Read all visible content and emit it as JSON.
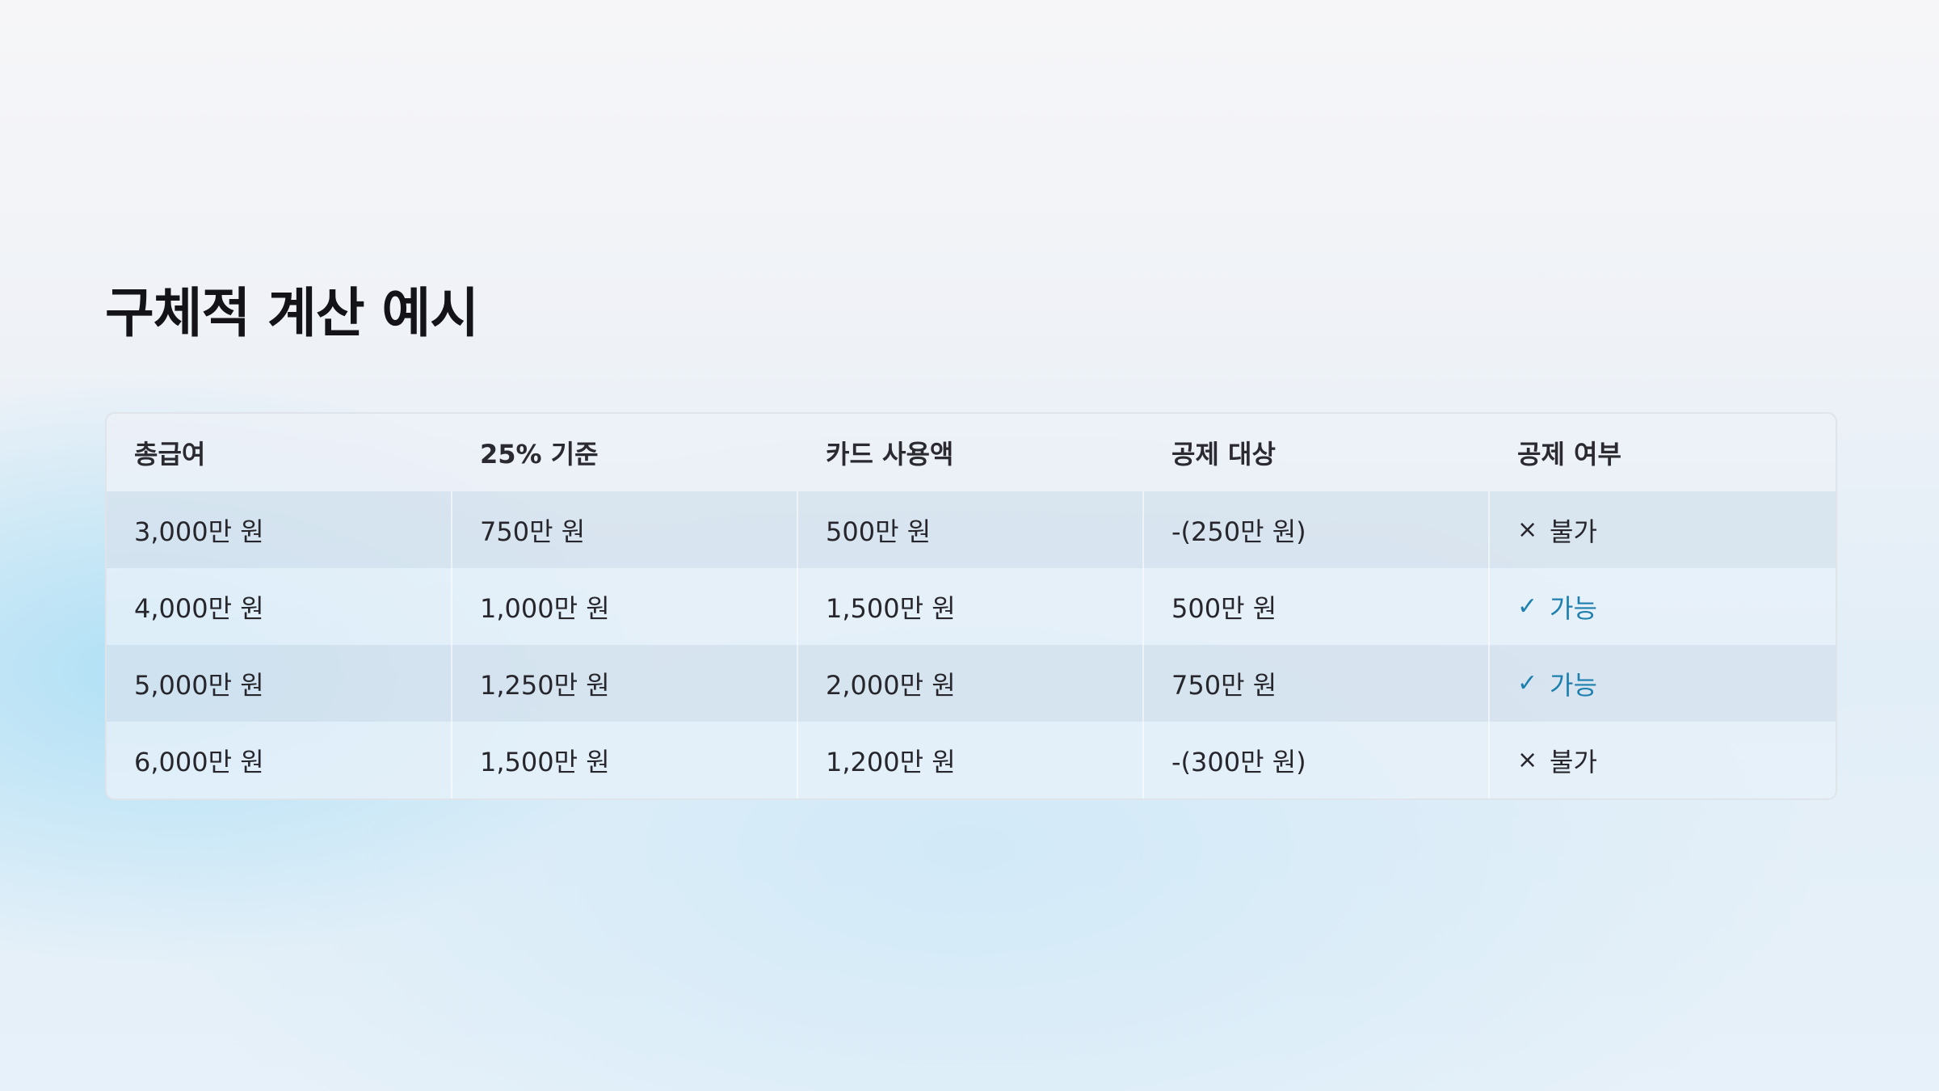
{
  "title": "구체적 계산 예시",
  "table": {
    "headers": [
      "총급여",
      "25% 기준",
      "카드 사용액",
      "공제 대상",
      "공제 여부"
    ],
    "rows": [
      {
        "salary": "3,000만 원",
        "threshold": "750만 원",
        "card": "500만 원",
        "deductible": "-(250만 원)",
        "status_icon": "×",
        "status": "불가",
        "eligible": false
      },
      {
        "salary": "4,000만 원",
        "threshold": "1,000만 원",
        "card": "1,500만 원",
        "deductible": "500만 원",
        "status_icon": "✓",
        "status": "가능",
        "eligible": true
      },
      {
        "salary": "5,000만 원",
        "threshold": "1,250만 원",
        "card": "2,000만 원",
        "deductible": "750만 원",
        "status_icon": "✓",
        "status": "가능",
        "eligible": true
      },
      {
        "salary": "6,000만 원",
        "threshold": "1,500만 원",
        "card": "1,200만 원",
        "deductible": "-(300만 원)",
        "status_icon": "×",
        "status": "불가",
        "eligible": false
      }
    ]
  },
  "colors": {
    "accent": "#1d7fae",
    "text": "#26262c"
  }
}
